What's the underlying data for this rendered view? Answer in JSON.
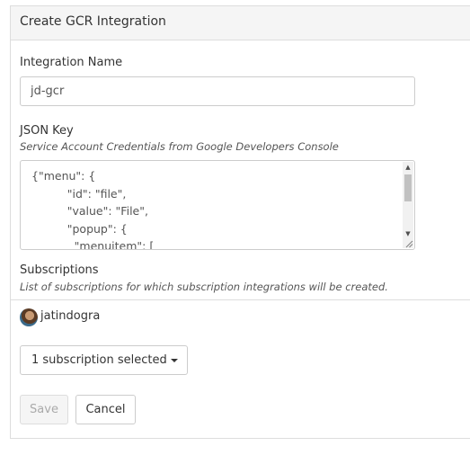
{
  "panel": {
    "title": "Create GCR Integration"
  },
  "integration_name": {
    "label": "Integration Name",
    "value": "jd-gcr"
  },
  "json_key": {
    "label": "JSON Key",
    "help": "Service Account Credentials from Google Developers Console",
    "content": "{\"menu\": {\n          \"id\": \"file\",\n          \"value\": \"File\",\n          \"popup\": {\n            \"menuitem\": ["
  },
  "subscriptions": {
    "label": "Subscriptions",
    "help": "List of subscriptions for which subscription integrations will be created.",
    "user": "jatindogra",
    "dropdown_label": "1 subscription selected"
  },
  "buttons": {
    "save": "Save",
    "cancel": "Cancel"
  },
  "icons": {
    "dropdown": "caret-down-icon",
    "avatar": "user-avatar",
    "scroll_up": "arrow-up-icon",
    "scroll_down": "arrow-down-icon"
  }
}
